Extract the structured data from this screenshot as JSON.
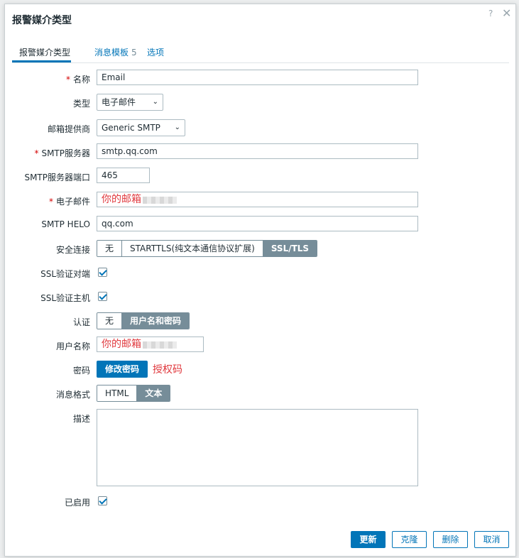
{
  "dialog": {
    "title": "报警媒介类型",
    "help_glyph": "?",
    "close_glyph": "✕"
  },
  "tabs": [
    {
      "label": "报警媒介类型",
      "count": ""
    },
    {
      "label": "消息模板",
      "count": "5"
    },
    {
      "label": "选项",
      "count": ""
    }
  ],
  "form": {
    "name": {
      "label": "名称",
      "value": "Email",
      "required": true
    },
    "type": {
      "label": "类型",
      "value": "电子邮件"
    },
    "provider": {
      "label": "邮箱提供商",
      "value": "Generic SMTP"
    },
    "smtp_server": {
      "label": "SMTP服务器",
      "value": "smtp.qq.com",
      "required": true
    },
    "smtp_port": {
      "label": "SMTP服务器端口",
      "value": "465"
    },
    "email": {
      "label": "电子邮件",
      "annotation": "你的邮箱",
      "required": true
    },
    "smtp_helo": {
      "label": "SMTP HELO",
      "value": "qq.com"
    },
    "security": {
      "label": "安全连接",
      "options": [
        "无",
        "STARTTLS(纯文本通信协议扩展)",
        "SSL/TLS"
      ],
      "selected": "SSL/TLS"
    },
    "ssl_verify_peer": {
      "label": "SSL验证对端",
      "checked": true
    },
    "ssl_verify_host": {
      "label": "SSL验证主机",
      "checked": true
    },
    "auth": {
      "label": "认证",
      "options": [
        "无",
        "用户名和密码"
      ],
      "selected": "用户名和密码"
    },
    "username": {
      "label": "用户名称",
      "annotation": "你的邮箱"
    },
    "password": {
      "label": "密码",
      "button": "修改密码",
      "annotation": "授权码"
    },
    "message_format": {
      "label": "消息格式",
      "options": [
        "HTML",
        "文本"
      ],
      "selected": "文本"
    },
    "description": {
      "label": "描述",
      "value": ""
    },
    "enabled": {
      "label": "已启用",
      "checked": true
    }
  },
  "footer": {
    "update": "更新",
    "clone": "克隆",
    "delete": "删除",
    "cancel": "取消"
  },
  "colors": {
    "accent": "#0275b8",
    "segment_active": "#768d99",
    "required": "#d40000",
    "annotation": "#e0393e"
  }
}
